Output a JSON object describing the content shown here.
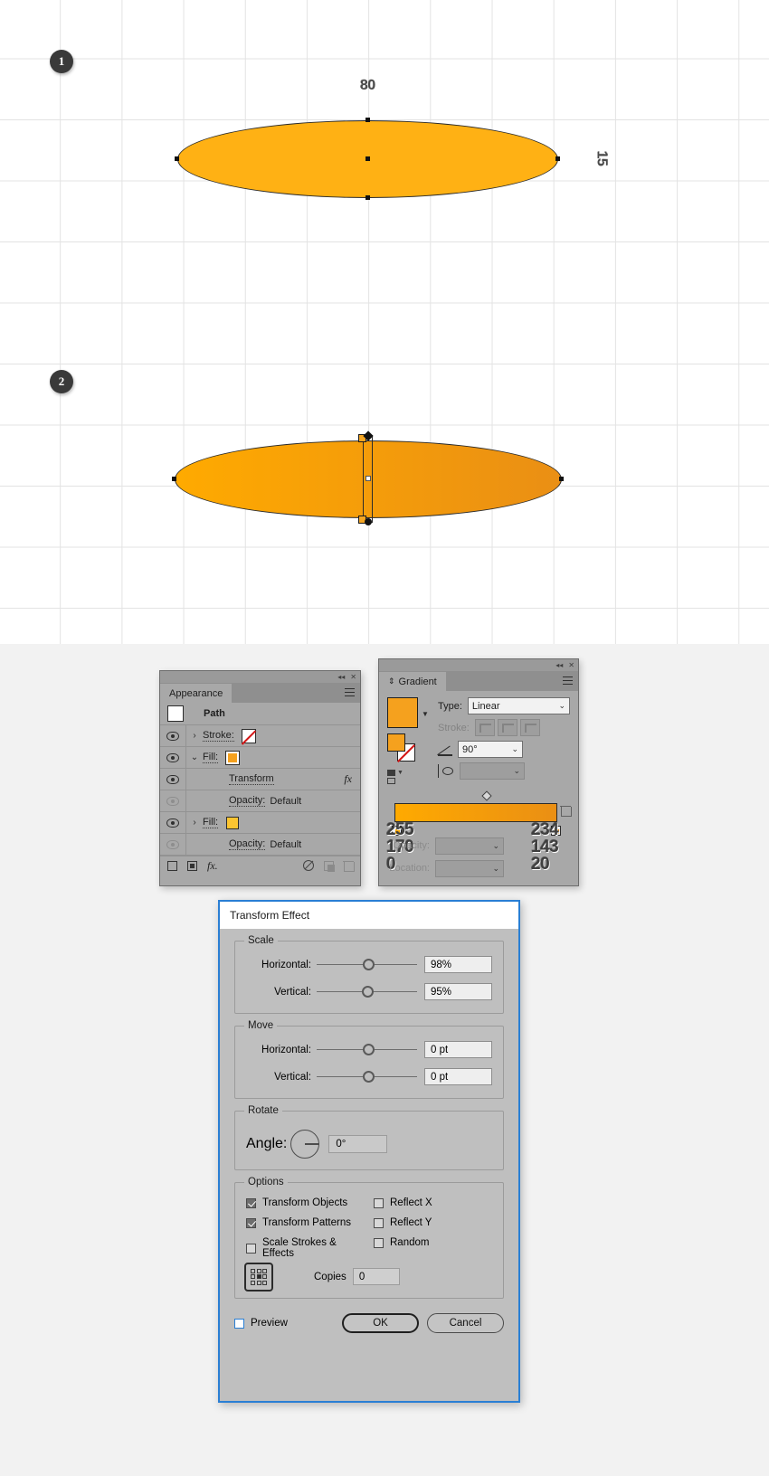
{
  "canvas": {
    "step1_badge": "1",
    "step2_badge": "2",
    "width_label": "80",
    "height_label": "15"
  },
  "appearance": {
    "tab_label": "Appearance",
    "collapse_icon": "collapse-icon",
    "close_icon": "close-icon",
    "menu_icon": "panel-menu-icon",
    "rows": [
      {
        "label": "Path"
      },
      {
        "label": "Stroke:"
      },
      {
        "label": "Fill:"
      },
      {
        "label": "Transform",
        "fx": "fx"
      },
      {
        "label": "Opacity:",
        "value": "Default"
      },
      {
        "label": "Fill:"
      },
      {
        "label": "Opacity:",
        "value": "Default"
      }
    ],
    "footer_icons": [
      "add-new-stroke-icon",
      "add-new-fill-icon",
      "add-new-effect-icon",
      "clear-appearance-icon",
      "duplicate-item-icon",
      "delete-item-icon"
    ]
  },
  "gradient": {
    "tab_label": "Gradient",
    "collapse_icon": "collapse-icon",
    "close_icon": "close-icon",
    "menu_icon": "panel-menu-icon",
    "type_label": "Type:",
    "type_value": "Linear",
    "stroke_label": "Stroke:",
    "angle_value": "90°",
    "opacity_label": "Opacity:",
    "location_label": "Location:",
    "stop_left_rgb": [
      "255",
      "170",
      "0"
    ],
    "stop_right_rgb": [
      "234",
      "143",
      "20"
    ],
    "gradient_start_color": "#ffaa00",
    "gradient_end_color": "#ea8f14"
  },
  "transform_dialog": {
    "title": "Transform Effect",
    "scale": {
      "legend": "Scale",
      "horizontal_label": "Horizontal:",
      "horizontal_value": "98%",
      "vertical_label": "Vertical:",
      "vertical_value": "95%"
    },
    "move": {
      "legend": "Move",
      "horizontal_label": "Horizontal:",
      "horizontal_value": "0 pt",
      "vertical_label": "Vertical:",
      "vertical_value": "0 pt"
    },
    "rotate": {
      "legend": "Rotate",
      "angle_label": "Angle:",
      "angle_value": "0°"
    },
    "options": {
      "legend": "Options",
      "transform_objects": "Transform Objects",
      "transform_patterns": "Transform Patterns",
      "scale_strokes": "Scale Strokes & Effects",
      "reflect_x": "Reflect X",
      "reflect_y": "Reflect Y",
      "random": "Random",
      "copies_label": "Copies",
      "copies_value": "0"
    },
    "preview_label": "Preview",
    "ok_label": "OK",
    "cancel_label": "Cancel"
  }
}
